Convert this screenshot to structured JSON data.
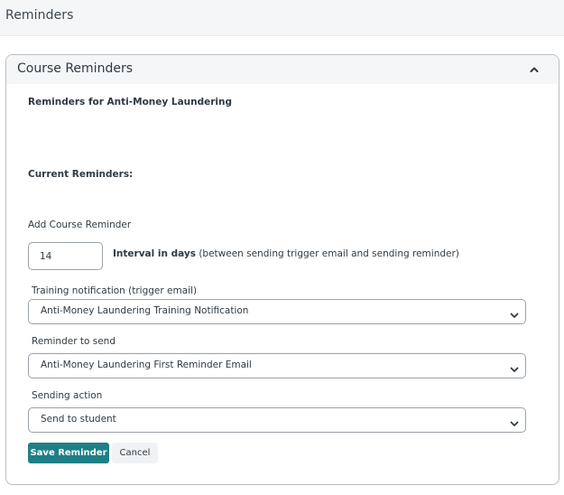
{
  "page": {
    "title": "Reminders"
  },
  "panel": {
    "title": "Course Reminders",
    "collapse_icon": "chevron-up-icon",
    "reminders_for": "Reminders for Anti-Money Laundering",
    "current_reminders_label": "Current Reminders:",
    "add_reminder_label": "Add Course Reminder"
  },
  "form": {
    "interval": {
      "value": "14",
      "label_bold": "Interval in days",
      "label_rest": " (between sending trigger email and sending reminder)"
    },
    "trigger": {
      "label": "Training notification (trigger email)",
      "selected": "Anti-Money Laundering Training Notification"
    },
    "reminder": {
      "label": "Reminder to send",
      "selected": "Anti-Money Laundering First Reminder Email"
    },
    "action": {
      "label": "Sending action",
      "selected": "Send to student"
    },
    "save_label": "Save Reminder",
    "cancel_label": "Cancel"
  },
  "colors": {
    "primary": "#1f7f86",
    "border": "#9aa2aa",
    "header_bg": "#f5f6f7"
  }
}
